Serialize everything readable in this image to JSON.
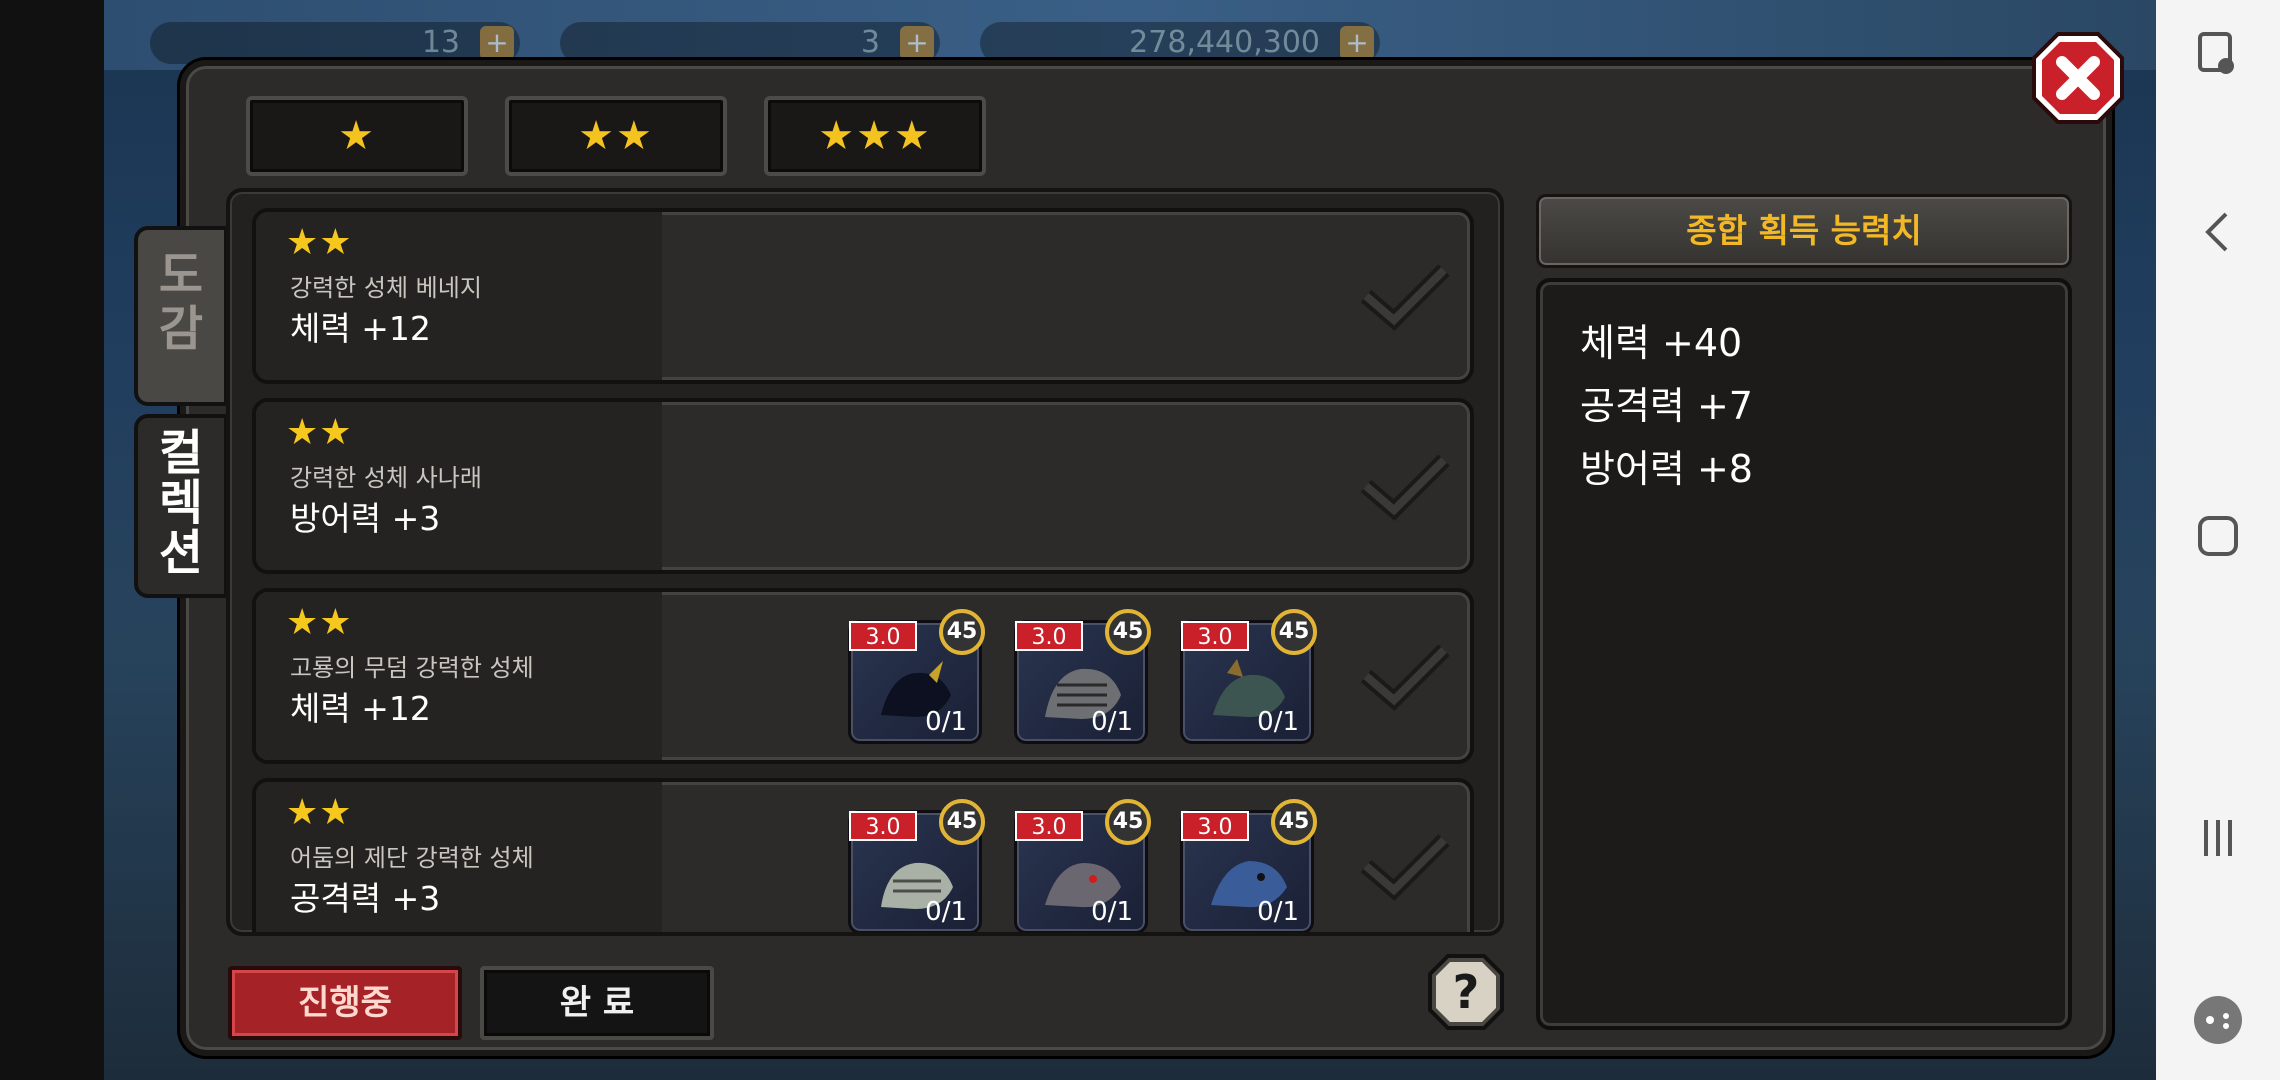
{
  "resources": [
    {
      "value": "13"
    },
    {
      "value": "3"
    },
    {
      "value": "278,440,300"
    }
  ],
  "star_tabs": [
    {
      "label": "★"
    },
    {
      "label": "★★"
    },
    {
      "label": "★★★"
    }
  ],
  "side_tabs": {
    "encyclopedia": "도\n감",
    "collection": "컬\n렉\n션"
  },
  "collections": [
    {
      "stars": "★★",
      "name": "강력한 성체 베네지",
      "stat": "체력 +12",
      "monsters": []
    },
    {
      "stars": "★★",
      "name": "강력한 성체 사나래",
      "stat": "방어력 +3",
      "monsters": []
    },
    {
      "stars": "★★",
      "name": "고룡의 무덤 강력한 성체",
      "stat": "체력 +12",
      "monsters": [
        {
          "level": "3.0",
          "badge": "45",
          "count": "0/1",
          "color": "#1e2438"
        },
        {
          "level": "3.0",
          "badge": "45",
          "count": "0/1",
          "color": "#3a3e48"
        },
        {
          "level": "3.0",
          "badge": "45",
          "count": "0/1",
          "color": "#2d3a3a"
        }
      ]
    },
    {
      "stars": "★★",
      "name": "어둠의 제단 강력한 성체",
      "stat": "공격력 +3",
      "monsters": [
        {
          "level": "3.0",
          "badge": "45",
          "count": "0/1",
          "color": "#4d5a55"
        },
        {
          "level": "3.0",
          "badge": "45",
          "count": "0/1",
          "color": "#3e3b42"
        },
        {
          "level": "3.0",
          "badge": "45",
          "count": "0/1",
          "color": "#23355a"
        }
      ]
    }
  ],
  "summary": {
    "title": "종합 획득 능력치",
    "lines": [
      "체력 +40",
      "공격력 +7",
      "방어력 +8"
    ]
  },
  "buttons": {
    "in_progress": "진행중",
    "completed": "완 료"
  },
  "help_label": "?",
  "colors": {
    "accent_gold": "#f3b826",
    "star": "#f6c81e",
    "red_button": "#a52226",
    "close_red": "#c9202a"
  }
}
